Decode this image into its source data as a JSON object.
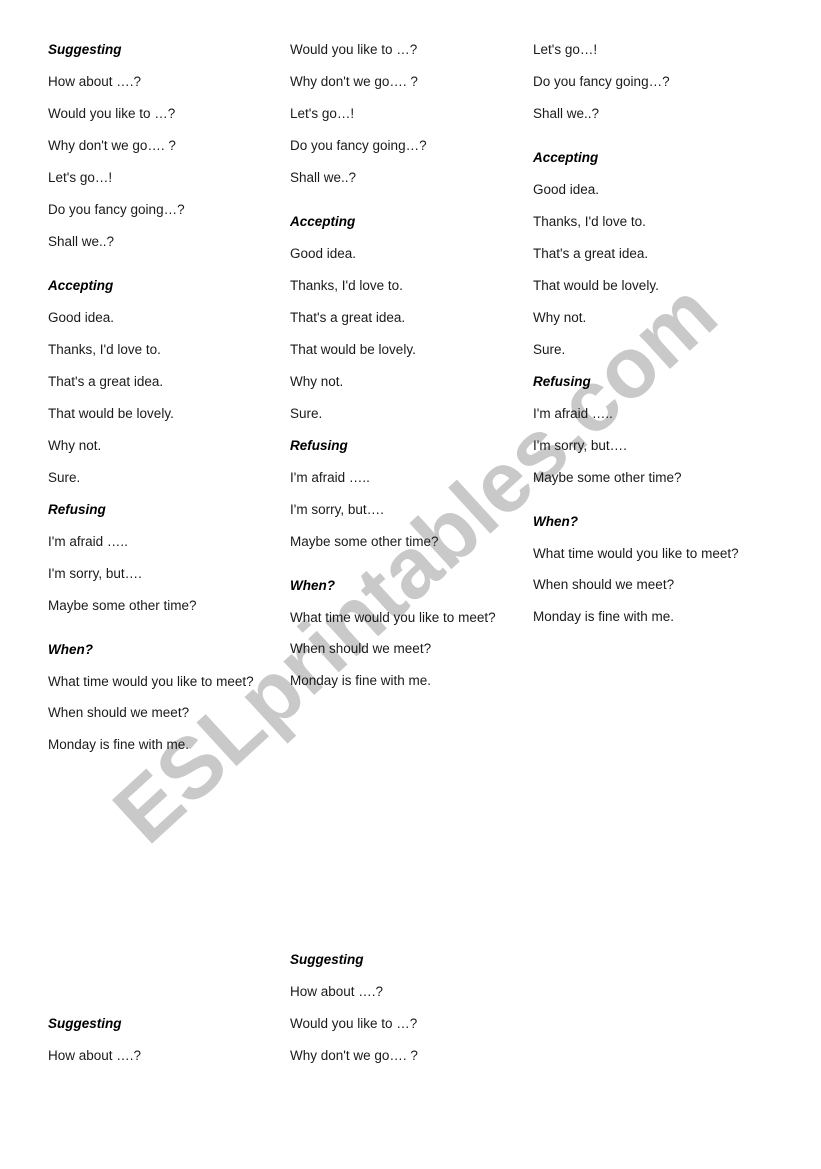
{
  "document": {
    "type": "esl-worksheet",
    "watermark": "ESLprintables.com",
    "watermark_color": "#c9c9c9",
    "background_color": "#ffffff",
    "text_color": "#1a1a1a"
  },
  "phrases": {
    "suggesting_heading": "Suggesting",
    "accepting_heading": "Accepting",
    "refusing_heading": "Refusing",
    "when_heading": "When?",
    "suggesting": [
      "How about ….?",
      "Would you like to …?",
      "Why don't we go…. ?",
      "Let's go…!",
      "Do you fancy going…?",
      "Shall we..?"
    ],
    "accepting": [
      "Good idea.",
      "Thanks, I'd love to.",
      "That's a great idea.",
      "That would be lovely.",
      "Why not.",
      "Sure."
    ],
    "refusing": [
      "I'm afraid …..",
      "I'm sorry, but….",
      "Maybe some other time?"
    ],
    "when": [
      "What time would you like to meet?",
      "When should we meet?",
      "Monday is fine with me."
    ]
  },
  "columns": {
    "col1": {
      "name": "left-column",
      "blocks": [
        {
          "heading": "Suggesting",
          "items": [
            "How about ….?",
            "Would you like to …?",
            "Why don't we go…. ?",
            "Let's go…!",
            "Do you fancy going…?",
            "Shall we..?"
          ]
        },
        {
          "heading": "Accepting",
          "items": [
            "Good idea.",
            "Thanks, I'd love to.",
            "That's a great idea.",
            "That would be lovely.",
            "Why not.",
            "Sure."
          ]
        },
        {
          "heading": "Refusing",
          "items": [
            "I'm afraid …..",
            "I'm sorry, but….",
            "Maybe some other time?"
          ]
        },
        {
          "heading": "When?",
          "items": [
            "What time would you like to meet?",
            "When should we meet?",
            "Monday is fine with me."
          ]
        }
      ]
    },
    "col2": {
      "name": "middle-column",
      "blocks": [
        {
          "heading": "",
          "items": [
            "Would you like to …?",
            "Why don't we go…. ?",
            "Let's go…!",
            "Do you fancy going…?",
            "Shall we..?"
          ]
        },
        {
          "heading": "Accepting",
          "items": [
            "Good idea.",
            "Thanks, I'd love to.",
            "That's a great idea.",
            "That would be lovely.",
            "Why not.",
            "Sure."
          ]
        },
        {
          "heading": "Refusing",
          "items": [
            "I'm afraid …..",
            "I'm sorry, but….",
            "Maybe some other time?"
          ]
        },
        {
          "heading": "When?",
          "items": [
            "What time would you like to meet?",
            "When should we meet?",
            "Monday is fine with me."
          ]
        }
      ]
    },
    "col3": {
      "name": "right-column",
      "blocks": [
        {
          "heading": "",
          "items": [
            "Let's go…!",
            "Do you fancy going…?",
            "Shall we..?"
          ]
        },
        {
          "heading": "Accepting",
          "items": [
            "Good idea.",
            "Thanks, I'd love to.",
            "That's a great idea.",
            "That would be lovely.",
            "Why not.",
            "Sure."
          ]
        },
        {
          "heading": "Refusing",
          "items": [
            "I'm afraid …..",
            "I'm sorry, but….",
            "Maybe some other time?"
          ]
        },
        {
          "heading": "When?",
          "items": [
            "What time would you like to meet?",
            "When should we meet?",
            "Monday is fine with me."
          ]
        }
      ]
    },
    "bottom_left": {
      "name": "bottom-left-column",
      "blocks": [
        {
          "heading": "Suggesting",
          "items": [
            "How about ….?"
          ]
        }
      ]
    },
    "bottom_middle": {
      "name": "bottom-middle-column",
      "blocks": [
        {
          "heading": "Suggesting",
          "items": [
            "How about ….?",
            "Would you like to …?",
            "Why don't we go…. ?"
          ]
        }
      ]
    }
  },
  "lines": {
    "c1": {
      "h_suggesting": "Suggesting",
      "s1": "How about ….?",
      "s2": "Would you like to …?",
      "s3": "Why don't we go…. ?",
      "s4": "Let's go…!",
      "s5": "Do you fancy going…?",
      "s6": "Shall we..?",
      "h_accepting": "Accepting",
      "a1": "Good idea.",
      "a2": "Thanks, I'd love to.",
      "a3": "That's a great idea.",
      "a4": "That would be lovely.",
      "a5": "Why not.",
      "a6": "Sure.",
      "h_refusing": "Refusing",
      "r1": "I'm afraid …..",
      "r2": "I'm sorry, but….",
      "r3": "Maybe some other time?",
      "h_when": "When?",
      "w1": "What time would you like to meet?",
      "w2": "When should we meet?",
      "w3": "Monday is fine with me."
    },
    "c2": {
      "s2": "Would you like to …?",
      "s3": "Why don't we go…. ?",
      "s4": "Let's go…!",
      "s5": "Do you fancy going…?",
      "s6": "Shall we..?",
      "h_accepting": "Accepting",
      "a1": "Good idea.",
      "a2": "Thanks, I'd love to.",
      "a3": "That's a great idea.",
      "a4": "That would be lovely.",
      "a5": "Why not.",
      "a6": "Sure.",
      "h_refusing": "Refusing",
      "r1": "I'm afraid …..",
      "r2": "I'm sorry, but….",
      "r3": "Maybe some other time?",
      "h_when": "When?",
      "w1": "What time would you like to meet?",
      "w2": "When should we meet?",
      "w3": "Monday is fine with me."
    },
    "c3": {
      "s4": "Let's go…!",
      "s5": "Do you fancy going…?",
      "s6": "Shall we..?",
      "h_accepting": "Accepting",
      "a1": "Good idea.",
      "a2": "Thanks, I'd love to.",
      "a3": "That's a great idea.",
      "a4": "That would be lovely.",
      "a5": "Why not.",
      "a6": "Sure.",
      "h_refusing": "Refusing",
      "r1": "I'm afraid …..",
      "r2": "I'm sorry, but….",
      "r3": "Maybe some other time?",
      "h_when": "When?",
      "w1": "What time would you like to meet?",
      "w2": "When should we meet?",
      "w3": "Monday is fine with me."
    },
    "b1": {
      "h_suggesting": "Suggesting",
      "s1": "How about ….?"
    },
    "b2": {
      "h_suggesting": "Suggesting",
      "s1": "How about ….?",
      "s2": "Would you like to …?",
      "s3": "Why don't we go…. ?"
    }
  }
}
